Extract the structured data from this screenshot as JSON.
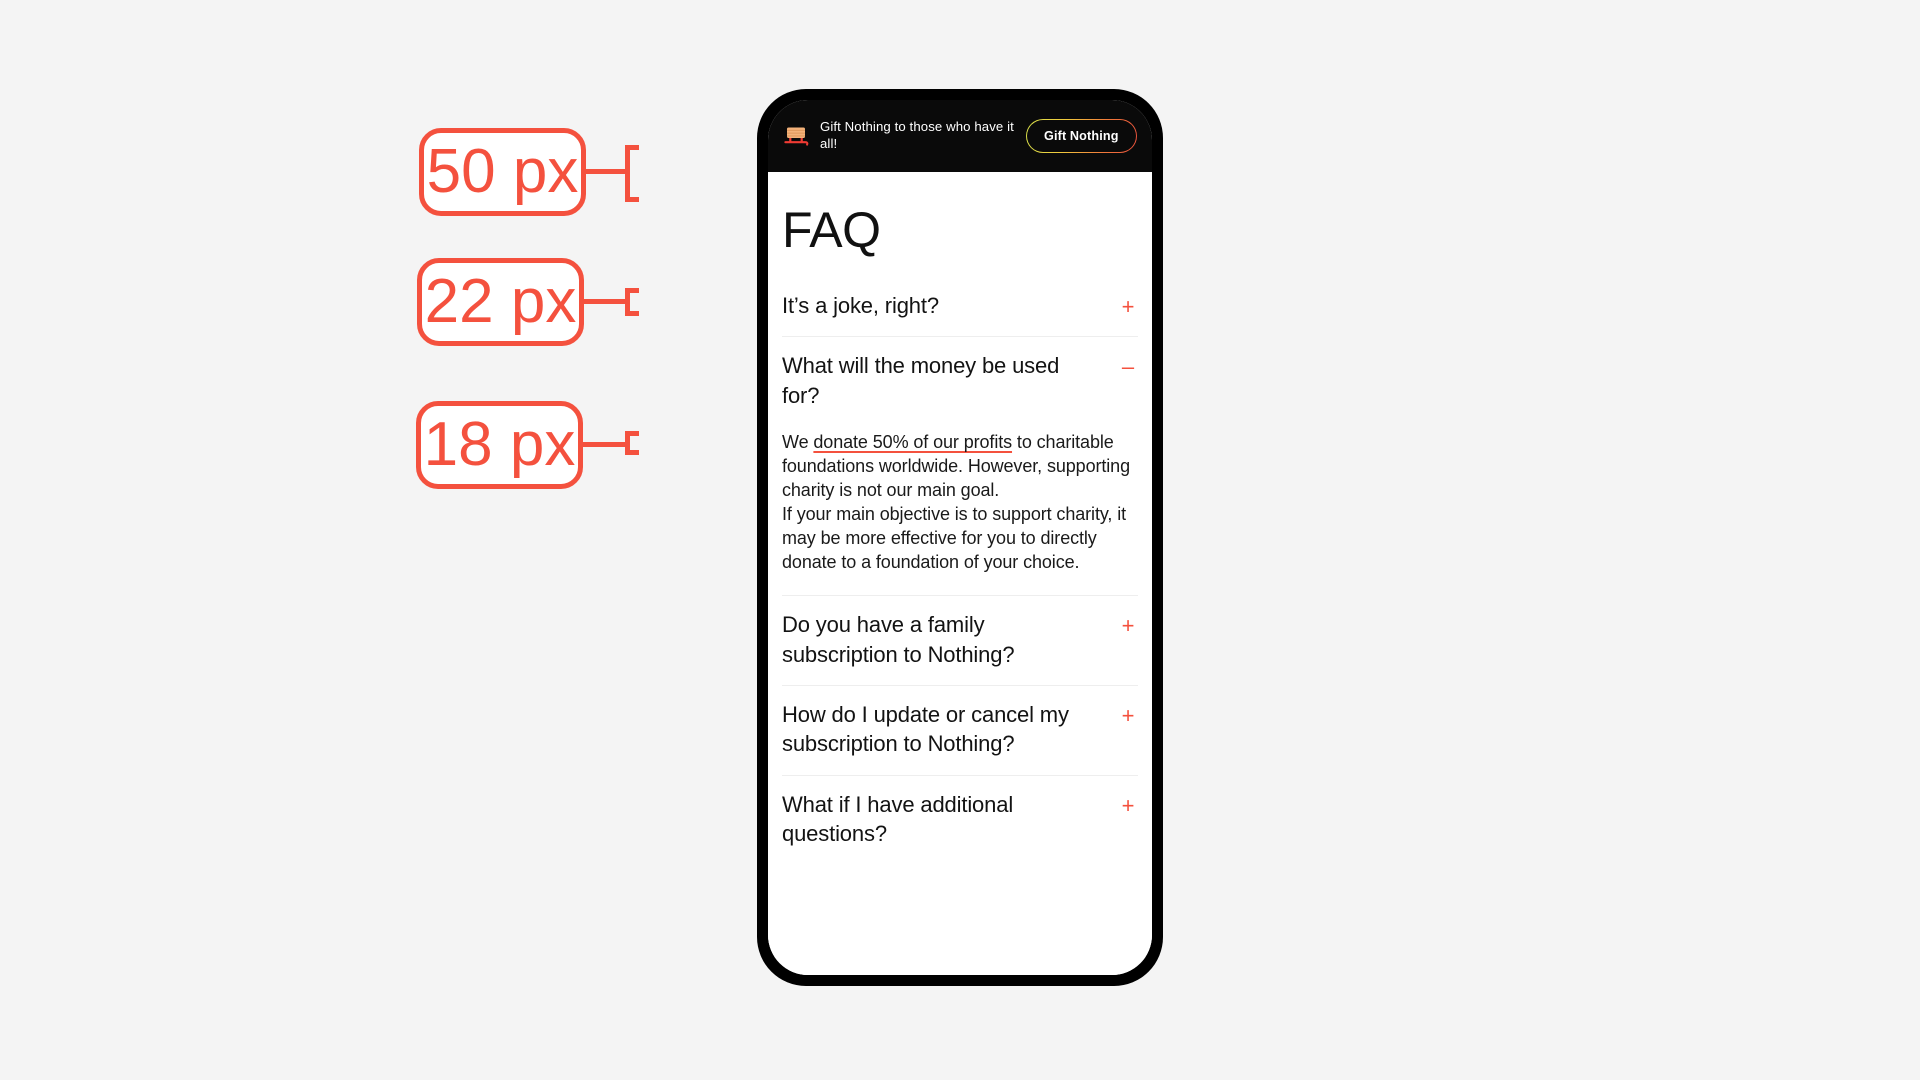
{
  "page": {
    "background_color": "#f4f4f4",
    "accent_color": "#f4513e"
  },
  "phone": {
    "promo_banner": {
      "icon": "sled-icon",
      "text": "Gift Nothing to those who have it all!",
      "cta_label": "Gift Nothing",
      "background_color": "#0a0a0a",
      "cta_gradient": [
        "#d8e24a",
        "#f0c83c",
        "#f07a3a",
        "#e8503c"
      ]
    },
    "faq": {
      "title": "FAQ",
      "items": [
        {
          "question": "It’s a joke, right?",
          "toggle_icon": "plus-icon",
          "toggle_glyph": "+",
          "expanded": false,
          "answer": null
        },
        {
          "question": "What will the money be used for?",
          "toggle_icon": "minus-icon",
          "toggle_glyph": "–",
          "expanded": true,
          "answer": {
            "paragraph_1_prefix": "We ",
            "paragraph_1_link": "donate 50% of our profits",
            "paragraph_1_suffix": " to charitable foundations worldwide. However, supporting charity is not our main goal.",
            "paragraph_2": "If your main objective is to support charity, it may be more effective for you to directly donate to a foundation of your choice."
          }
        },
        {
          "question": "Do you have a family subscription to Nothing?",
          "toggle_icon": "plus-icon",
          "toggle_glyph": "+",
          "expanded": false,
          "answer": null
        },
        {
          "question": "How do I update or cancel my subscription to Nothing?",
          "toggle_icon": "plus-icon",
          "toggle_glyph": "+",
          "expanded": false,
          "answer": null
        },
        {
          "question": "What if I have additional questions?",
          "toggle_icon": "plus-icon",
          "toggle_glyph": "+",
          "expanded": false,
          "answer": null
        }
      ]
    }
  },
  "annotations": [
    {
      "label": "50 px",
      "target": "faq-title"
    },
    {
      "label": "22 px",
      "target": "faq-question"
    },
    {
      "label": "18 px",
      "target": "faq-answer"
    }
  ]
}
